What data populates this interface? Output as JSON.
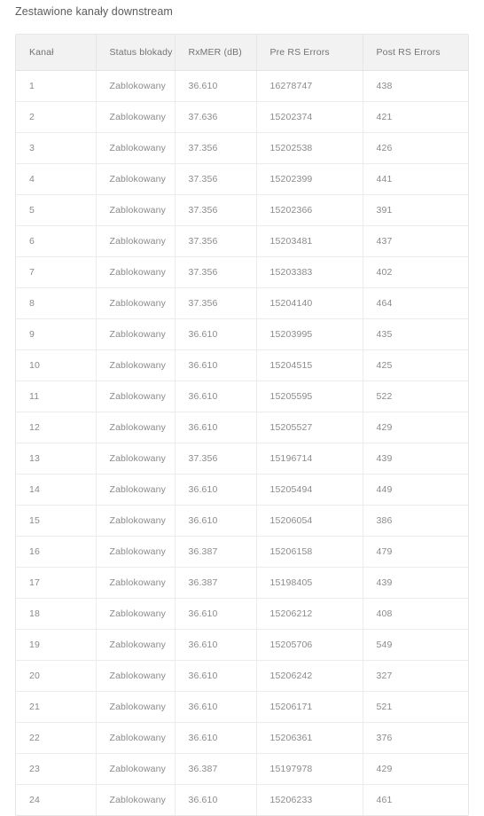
{
  "page": {
    "title": "Zestawione kanały downstream"
  },
  "table": {
    "columns": [
      {
        "key": "channel",
        "label": "Kanał"
      },
      {
        "key": "status",
        "label": "Status blokady"
      },
      {
        "key": "rxmer",
        "label": "RxMER (dB)"
      },
      {
        "key": "pre_rs",
        "label": "Pre RS Errors"
      },
      {
        "key": "post_rs",
        "label": "Post RS Errors"
      }
    ],
    "rows": [
      {
        "channel": "1",
        "status": "Zablokowany",
        "rxmer": "36.610",
        "pre_rs": "16278747",
        "post_rs": "438"
      },
      {
        "channel": "2",
        "status": "Zablokowany",
        "rxmer": "37.636",
        "pre_rs": "15202374",
        "post_rs": "421"
      },
      {
        "channel": "3",
        "status": "Zablokowany",
        "rxmer": "37.356",
        "pre_rs": "15202538",
        "post_rs": "426"
      },
      {
        "channel": "4",
        "status": "Zablokowany",
        "rxmer": "37.356",
        "pre_rs": "15202399",
        "post_rs": "441"
      },
      {
        "channel": "5",
        "status": "Zablokowany",
        "rxmer": "37.356",
        "pre_rs": "15202366",
        "post_rs": "391"
      },
      {
        "channel": "6",
        "status": "Zablokowany",
        "rxmer": "37.356",
        "pre_rs": "15203481",
        "post_rs": "437"
      },
      {
        "channel": "7",
        "status": "Zablokowany",
        "rxmer": "37.356",
        "pre_rs": "15203383",
        "post_rs": "402"
      },
      {
        "channel": "8",
        "status": "Zablokowany",
        "rxmer": "37.356",
        "pre_rs": "15204140",
        "post_rs": "464"
      },
      {
        "channel": "9",
        "status": "Zablokowany",
        "rxmer": "36.610",
        "pre_rs": "15203995",
        "post_rs": "435"
      },
      {
        "channel": "10",
        "status": "Zablokowany",
        "rxmer": "36.610",
        "pre_rs": "15204515",
        "post_rs": "425"
      },
      {
        "channel": "11",
        "status": "Zablokowany",
        "rxmer": "36.610",
        "pre_rs": "15205595",
        "post_rs": "522"
      },
      {
        "channel": "12",
        "status": "Zablokowany",
        "rxmer": "36.610",
        "pre_rs": "15205527",
        "post_rs": "429"
      },
      {
        "channel": "13",
        "status": "Zablokowany",
        "rxmer": "37.356",
        "pre_rs": "15196714",
        "post_rs": "439"
      },
      {
        "channel": "14",
        "status": "Zablokowany",
        "rxmer": "36.610",
        "pre_rs": "15205494",
        "post_rs": "449"
      },
      {
        "channel": "15",
        "status": "Zablokowany",
        "rxmer": "36.610",
        "pre_rs": "15206054",
        "post_rs": "386"
      },
      {
        "channel": "16",
        "status": "Zablokowany",
        "rxmer": "36.387",
        "pre_rs": "15206158",
        "post_rs": "479"
      },
      {
        "channel": "17",
        "status": "Zablokowany",
        "rxmer": "36.387",
        "pre_rs": "15198405",
        "post_rs": "439"
      },
      {
        "channel": "18",
        "status": "Zablokowany",
        "rxmer": "36.610",
        "pre_rs": "15206212",
        "post_rs": "408"
      },
      {
        "channel": "19",
        "status": "Zablokowany",
        "rxmer": "36.610",
        "pre_rs": "15205706",
        "post_rs": "549"
      },
      {
        "channel": "20",
        "status": "Zablokowany",
        "rxmer": "36.610",
        "pre_rs": "15206242",
        "post_rs": "327"
      },
      {
        "channel": "21",
        "status": "Zablokowany",
        "rxmer": "36.610",
        "pre_rs": "15206171",
        "post_rs": "521"
      },
      {
        "channel": "22",
        "status": "Zablokowany",
        "rxmer": "36.610",
        "pre_rs": "15206361",
        "post_rs": "376"
      },
      {
        "channel": "23",
        "status": "Zablokowany",
        "rxmer": "36.387",
        "pre_rs": "15197978",
        "post_rs": "429"
      },
      {
        "channel": "24",
        "status": "Zablokowany",
        "rxmer": "36.610",
        "pre_rs": "15206233",
        "post_rs": "461"
      }
    ]
  },
  "colors": {
    "page_background": "#ffffff",
    "header_background": "#f2f2f2",
    "table_border": "#e6e6e6",
    "row_border": "#ececec",
    "title_text": "#5c5c5c",
    "header_text": "#737373",
    "cell_text": "#8a8a8a"
  }
}
